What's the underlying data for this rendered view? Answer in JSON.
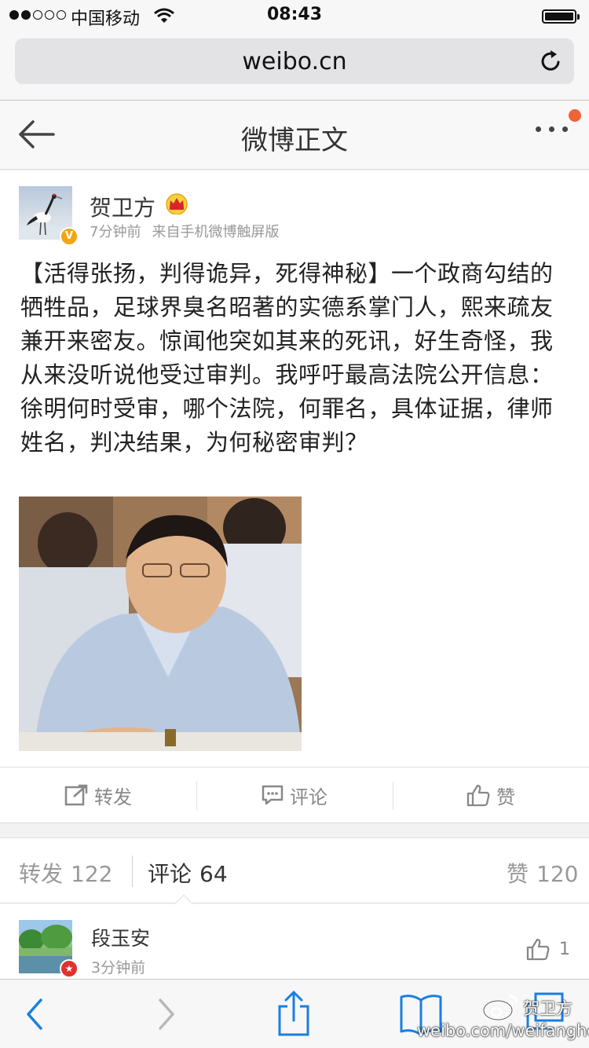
{
  "status_bar": {
    "carrier": "中国移动",
    "time": "08:43"
  },
  "browser": {
    "url": "weibo.cn"
  },
  "header": {
    "title": "微博正文"
  },
  "post": {
    "author": "贺卫方",
    "time": "7分钟前",
    "source": "来自手机微博触屏版",
    "text": "【活得张扬，判得诡异，死得神秘】一个政商勾结的牺牲品，足球界臭名昭著的实德系掌门人，熙来疏友兼开来密友。惊闻他突如其来的死讯，好生奇怪，我从来没听说他受过审判。我呼吁最高法院公开信息：徐明何时受审，哪个法院，何罪名，具体证据，律师姓名，判决结果，为何秘密审判？",
    "actions": {
      "repost": "转发",
      "comment": "评论",
      "like": "赞"
    }
  },
  "tabs": {
    "repost_label": "转发",
    "repost_count": "122",
    "comment_label": "评论",
    "comment_count": "64",
    "like_label": "赞",
    "like_count": "120",
    "active": "comment"
  },
  "comments": [
    {
      "name": "段玉安",
      "time": "3分钟前",
      "likes": "1"
    }
  ],
  "watermark": {
    "name": "贺卫方",
    "url": "weibo.com/weifanghe"
  },
  "colors": {
    "accent_blue": "#1a7fe0",
    "notification": "#f0623a",
    "verified": "#f4a50f",
    "member_badge": "#e0322e"
  }
}
